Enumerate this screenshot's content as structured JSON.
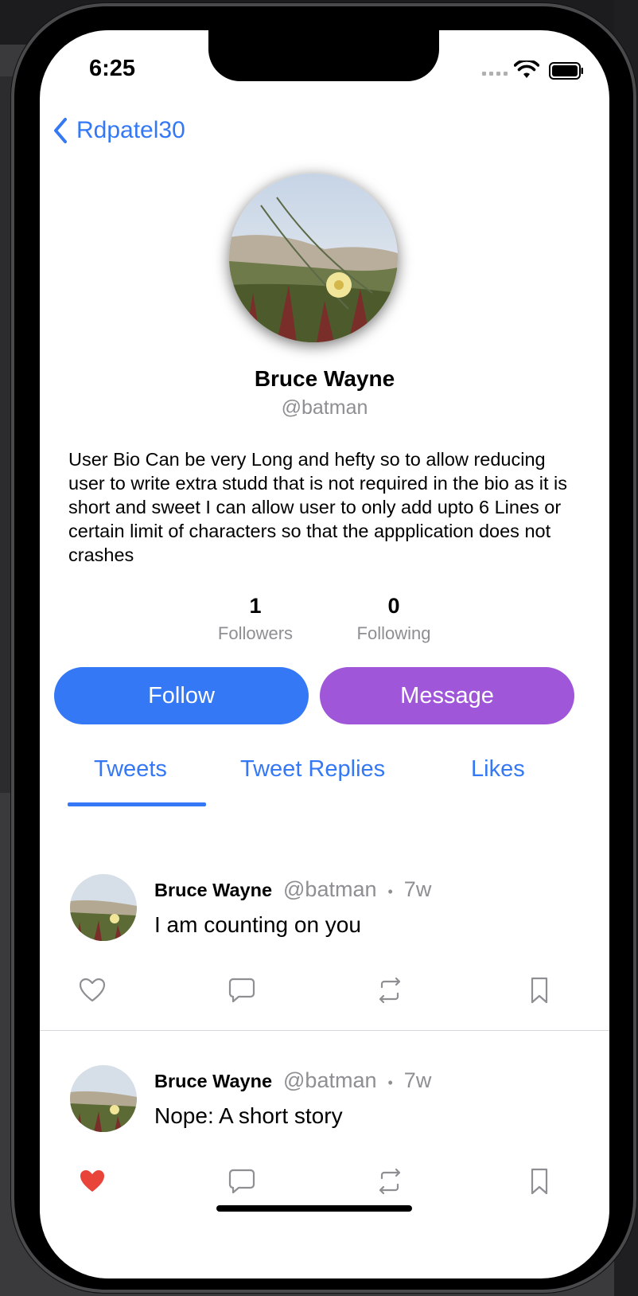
{
  "status_bar": {
    "time": "6:25"
  },
  "nav": {
    "back_label": "Rdpatel30"
  },
  "profile": {
    "name": "Bruce Wayne",
    "handle": "@batman",
    "bio": " User Bio Can be very Long and hefty so to allow reducing user to write extra studd that is not required in the bio as it is short and sweet I can allow user to only add upto 6 Lines or certain limit of characters so that the appplication does not crashes",
    "followers_count": "1",
    "followers_label": "Followers",
    "following_count": "0",
    "following_label": "Following"
  },
  "actions": {
    "follow_label": "Follow",
    "message_label": "Message"
  },
  "tabs": [
    {
      "label": "Tweets",
      "selected": true
    },
    {
      "label": "Tweet Replies",
      "selected": false
    },
    {
      "label": "Likes",
      "selected": false
    }
  ],
  "tweets": [
    {
      "name": "Bruce Wayne",
      "handle": "@batman",
      "dot": "•",
      "time": "7w",
      "text": "I am counting on you",
      "liked": false
    },
    {
      "name": "Bruce Wayne",
      "handle": "@batman",
      "dot": "•",
      "time": "7w",
      "text": "Nope: A short story",
      "liked": true
    }
  ],
  "icons": {
    "like": "heart-icon",
    "comment": "speech-bubble-icon",
    "retweet": "retweet-icon",
    "bookmark": "bookmark-icon"
  },
  "colors": {
    "accent": "#3478f6",
    "message": "#9f56d8",
    "liked": "#e9443a",
    "secondary_text": "#8e8e93"
  }
}
